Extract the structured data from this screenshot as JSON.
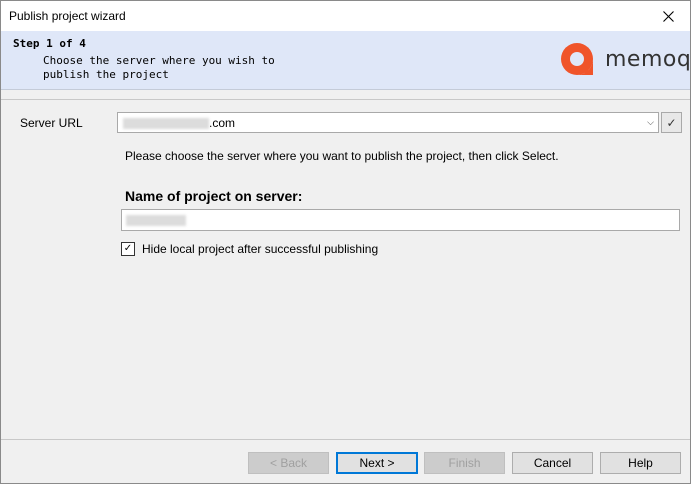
{
  "window": {
    "title": "Publish project wizard"
  },
  "header": {
    "step": "Step 1 of 4",
    "description_line1": "Choose the server where you wish to",
    "description_line2": "publish the project",
    "brand": "memoq",
    "brand_color": "#f0542a"
  },
  "server": {
    "label": "Server URL",
    "value_suffix": ".com",
    "hint": "Please choose the server where you want to publish the project, then click Select."
  },
  "project": {
    "name_label": "Name of project on server:",
    "hide_label": "Hide local project after successful publishing",
    "hide_checked": true
  },
  "buttons": {
    "back": "< Back",
    "next": "Next >",
    "finish": "Finish",
    "cancel": "Cancel",
    "help": "Help"
  }
}
